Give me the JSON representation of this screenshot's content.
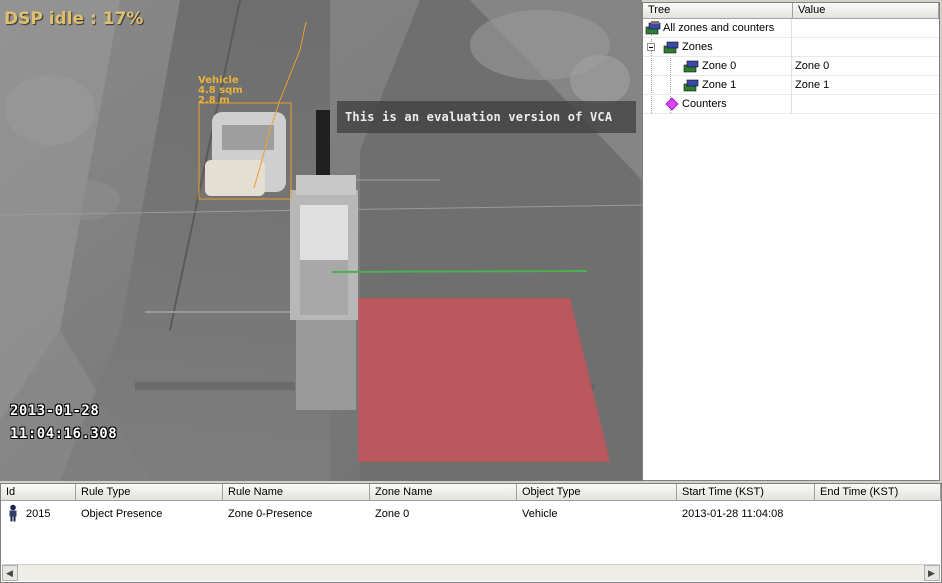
{
  "video": {
    "dsp_status": "DSP idle : 17%",
    "eval_notice": "This is an evaluation version of VCA",
    "timestamp_date": "2013-01-28",
    "timestamp_time": "11:04:16.308",
    "object_label": {
      "class": "Vehicle",
      "area": "4.8 sqm",
      "height": "2.8 m"
    },
    "colors": {
      "zone_fill": "#c8565a",
      "line_rule": "#4caf50",
      "track_color": "#e8a030"
    }
  },
  "tree": {
    "columns": [
      "Tree",
      "Value"
    ],
    "rows": [
      {
        "label": "All zones and counters",
        "value": "",
        "icon": "zones-root-icon"
      },
      {
        "label": "Zones",
        "value": "",
        "icon": "zones-folder-icon",
        "expanded": true
      },
      {
        "label": "Zone 0",
        "value": "Zone 0",
        "icon": "zone-icon"
      },
      {
        "label": "Zone 1",
        "value": "Zone 1",
        "icon": "zone-icon"
      },
      {
        "label": "Counters",
        "value": "",
        "icon": "counter-icon"
      }
    ]
  },
  "events": {
    "columns": [
      "Id",
      "Rule Type",
      "Rule Name",
      "Zone Name",
      "Object Type",
      "Start Time (KST)",
      "End Time (KST)"
    ],
    "rows": [
      {
        "id": "2015",
        "rule_type": "Object Presence",
        "rule_name": "Zone 0-Presence",
        "zone_name": "Zone 0",
        "object_type": "Vehicle",
        "start_time": "2013-01-28 11:04:08",
        "end_time": "",
        "icon": "person-icon"
      }
    ]
  }
}
